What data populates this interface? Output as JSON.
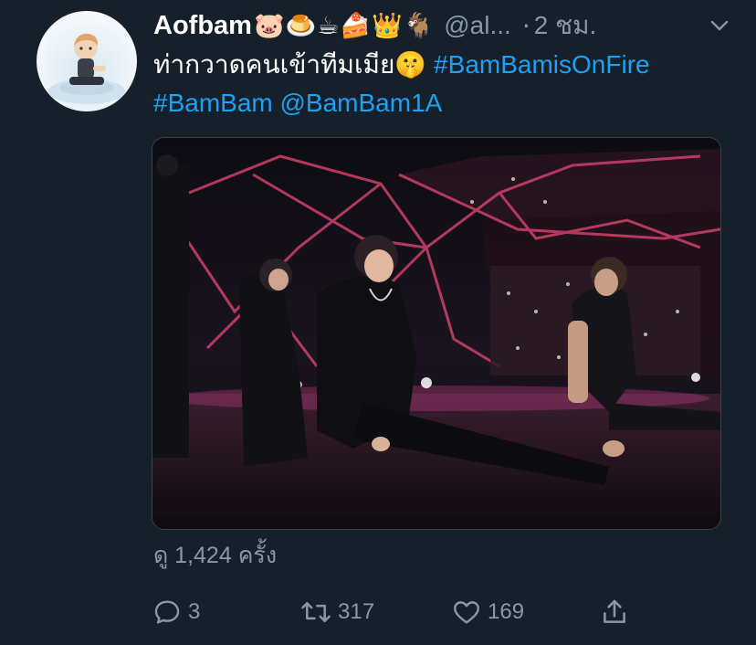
{
  "tweet": {
    "display_name": "Aofbam",
    "name_emojis": "🐷🍮☕🍰👑🐐",
    "handle": "@al...",
    "separator": "·",
    "time": "2 ชม.",
    "text": "ท่ากวาดคนเข้าทีมเมีย",
    "text_emoji": "🤫",
    "hashtag_1": "#BamBamisOnFire",
    "hashtag_2": "#BamBam",
    "mention": "@BamBam1A",
    "views": "ดู 1,424 ครั้ง"
  },
  "actions": {
    "reply_count": "3",
    "retweet_count": "317",
    "like_count": "169"
  },
  "icons": {
    "reply": "reply-icon",
    "retweet": "retweet-icon",
    "like": "heart-icon",
    "share": "share-icon",
    "menu": "chevron-down-icon"
  },
  "colors": {
    "background": "#15202b",
    "link": "#1da1f2",
    "secondary": "#8899a6"
  }
}
